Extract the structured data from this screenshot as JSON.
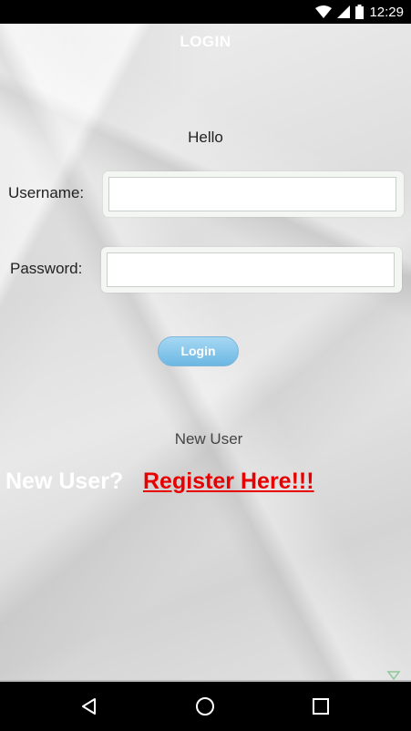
{
  "status_bar": {
    "time": "12:29",
    "icons": [
      "wifi-icon",
      "signal-icon",
      "battery-icon"
    ]
  },
  "page": {
    "title": "LOGIN",
    "greeting": "Hello"
  },
  "form": {
    "username_label": "Username:",
    "username_value": "",
    "password_label": "Password:",
    "password_value": "",
    "login_label": "Login"
  },
  "footer": {
    "new_user_text": "New User",
    "new_user_prompt": "New User?",
    "register_link": "Register Here!!!"
  },
  "nav_bar": {
    "buttons": [
      "back-icon",
      "home-icon",
      "recents-icon"
    ]
  },
  "colors": {
    "register_link": "#e80000",
    "login_button": "#6bb7e3",
    "title": "#ffffff"
  }
}
